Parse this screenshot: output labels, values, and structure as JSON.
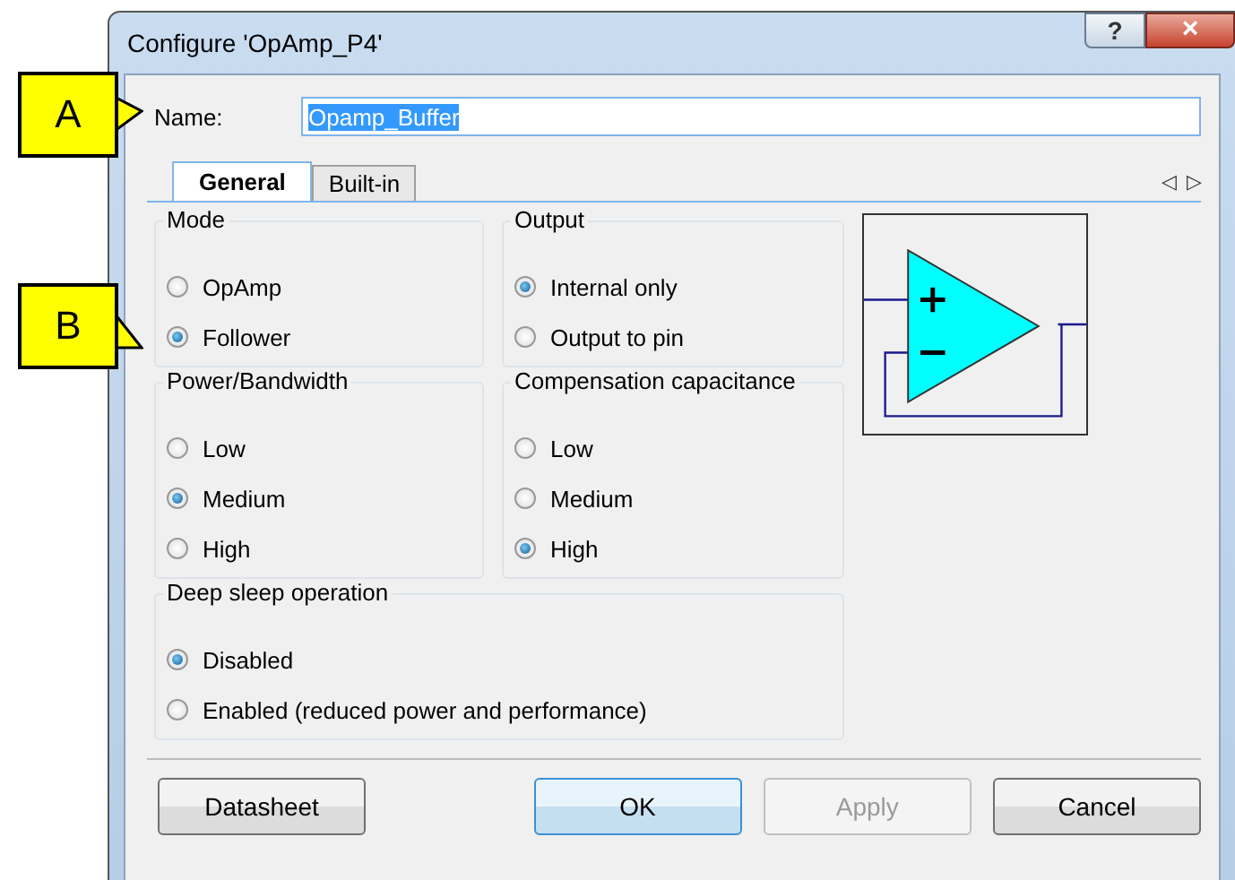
{
  "callouts": [
    {
      "label": "A"
    },
    {
      "label": "B"
    }
  ],
  "window": {
    "title": "Configure 'OpAmp_P4'",
    "help": "?",
    "close": "×"
  },
  "name_field": {
    "label": "Name:",
    "value": "Opamp_Buffer"
  },
  "tabs": [
    {
      "label": "General",
      "selected": true
    },
    {
      "label": "Built-in",
      "selected": false
    }
  ],
  "tab_scroll": {
    "left": "◁",
    "right": "▷"
  },
  "groups": [
    {
      "title": "Mode",
      "options": [
        {
          "label": "OpAmp",
          "selected": false
        },
        {
          "label": "Follower",
          "selected": true
        }
      ]
    },
    {
      "title": "Output",
      "options": [
        {
          "label": "Internal only",
          "selected": true
        },
        {
          "label": "Output to pin",
          "selected": false
        }
      ]
    },
    {
      "title": "Power/Bandwidth",
      "options": [
        {
          "label": "Low",
          "selected": false
        },
        {
          "label": "Medium",
          "selected": true
        },
        {
          "label": "High",
          "selected": false
        }
      ]
    },
    {
      "title": "Compensation capacitance",
      "options": [
        {
          "label": "Low",
          "selected": false
        },
        {
          "label": "Medium",
          "selected": false
        },
        {
          "label": "High",
          "selected": true
        }
      ]
    },
    {
      "title": "Deep sleep operation",
      "options": [
        {
          "label": "Disabled",
          "selected": true
        },
        {
          "label": "Enabled (reduced power and performance)",
          "selected": false
        }
      ]
    }
  ],
  "buttons": [
    {
      "label": "Datasheet",
      "disabled": false,
      "default": false
    },
    {
      "label": "OK",
      "disabled": false,
      "default": true
    },
    {
      "label": "Apply",
      "disabled": true,
      "default": false
    },
    {
      "label": "Cancel",
      "disabled": false,
      "default": false
    }
  ]
}
